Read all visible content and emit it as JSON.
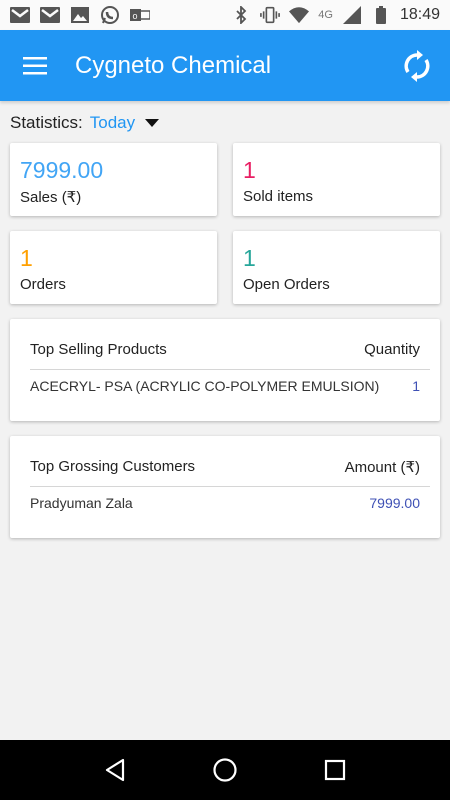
{
  "status_bar": {
    "time": "18:49",
    "network": "4G",
    "icons_left": [
      "gmail-icon",
      "gmail-icon",
      "gallery-icon",
      "whatsapp-icon",
      "outlook-icon"
    ],
    "icons_right": [
      "bluetooth-icon",
      "vibrate-icon",
      "wifi-icon",
      "signal-icon",
      "battery-icon"
    ]
  },
  "app_bar": {
    "title": "Cygneto Chemical",
    "color": "#2196f3"
  },
  "statistics": {
    "label": "Statistics:",
    "period": "Today"
  },
  "metrics": [
    {
      "value": "7999.00",
      "label": "Sales (₹)",
      "color": "#42a5f5"
    },
    {
      "value": "1",
      "label": "Sold items",
      "color": "#e91e63"
    },
    {
      "value": "1",
      "label": "Orders",
      "color": "#ffa000"
    },
    {
      "value": "1",
      "label": "Open Orders",
      "color": "#26a69a"
    }
  ],
  "top_selling": {
    "title": "Top Selling Products",
    "column": "Quantity",
    "rows": [
      {
        "name": "ACECRYL- PSA (ACRYLIC CO-POLYMER EMULSION)",
        "value": "1"
      }
    ]
  },
  "top_grossing": {
    "title": "Top Grossing Customers",
    "column": "Amount (₹)",
    "rows": [
      {
        "name": "Pradyuman Zala",
        "value": "7999.00"
      }
    ]
  }
}
